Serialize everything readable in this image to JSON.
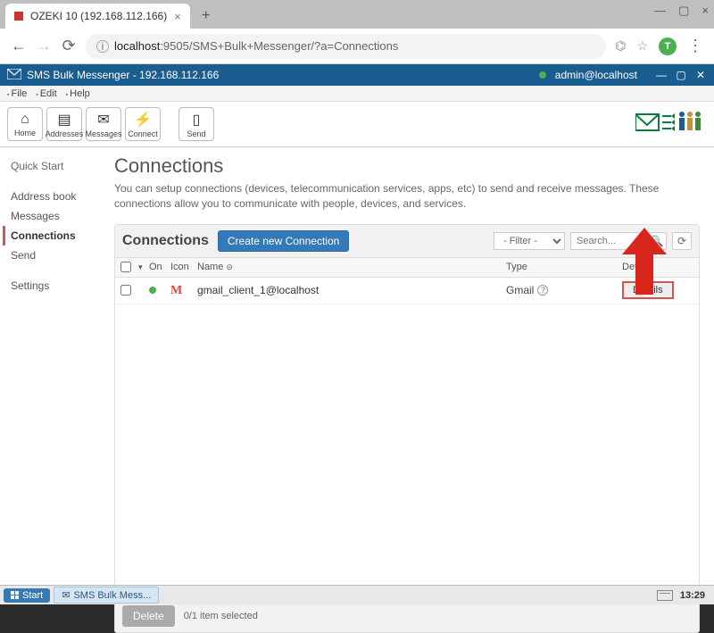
{
  "browser": {
    "tab_title": "OZEKI 10 (192.168.112.166)",
    "url_host": "localhost",
    "url_rest": ":9505/SMS+Bulk+Messenger/?a=Connections",
    "avatar_letter": "T"
  },
  "app_header": {
    "title": "SMS Bulk Messenger - 192.168.112.166",
    "user": "admin@localhost"
  },
  "menus": {
    "file": "File",
    "edit": "Edit",
    "help": "Help"
  },
  "toolbar": {
    "home": "Home",
    "addresses": "Addresses",
    "messages": "Messages",
    "connect": "Connect",
    "send": "Send"
  },
  "sidebar": {
    "quick_start": "Quick Start",
    "address_book": "Address book",
    "messages": "Messages",
    "connections": "Connections",
    "send": "Send",
    "settings": "Settings"
  },
  "page": {
    "title": "Connections",
    "desc": "You can setup connections (devices, telecommunication services, apps, etc) to send and receive messages. These connections allow you to communicate with people, devices, and services."
  },
  "panel": {
    "title": "Connections",
    "create_btn": "Create new Connection",
    "filter": "- Filter -",
    "search_placeholder": "Search...",
    "columns": {
      "on": "On",
      "icon": "Icon",
      "name": "Name",
      "type": "Type",
      "details": "Details"
    },
    "row": {
      "name": "gmail_client_1@localhost",
      "type": "Gmail",
      "details_btn": "Details"
    },
    "footer": {
      "delete": "Delete",
      "selected": "0/1 item selected"
    }
  },
  "taskbar": {
    "start": "Start",
    "task": "SMS Bulk Mess...",
    "clock": "13:29"
  }
}
